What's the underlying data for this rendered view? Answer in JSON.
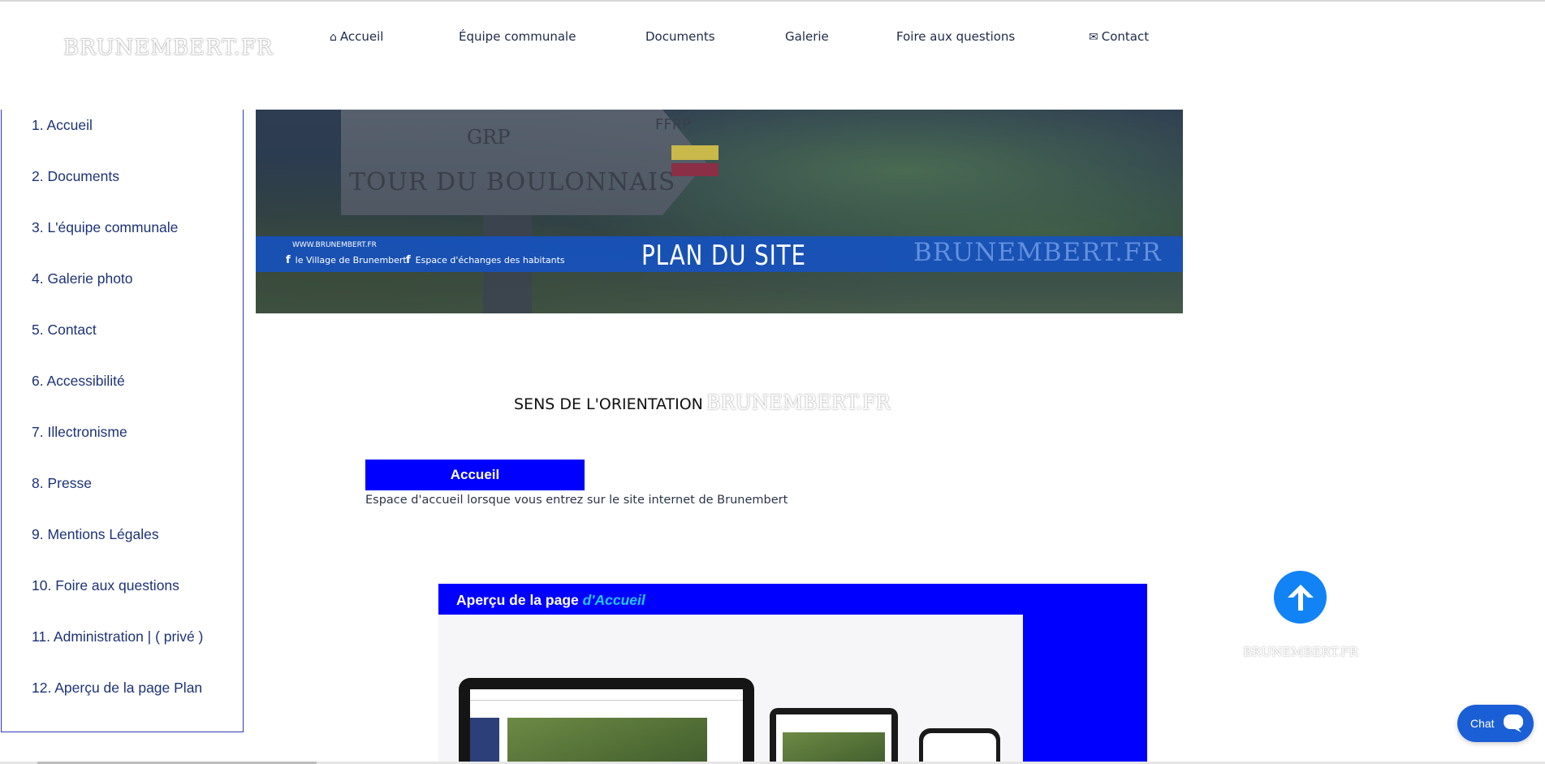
{
  "header": {
    "logo": "BRUNEMBERT.FR",
    "nav": [
      {
        "label": "Accueil",
        "icon": "home-icon"
      },
      {
        "label": "Équipe communale"
      },
      {
        "label": "Documents"
      },
      {
        "label": "Galerie"
      },
      {
        "label": "Foire aux questions"
      },
      {
        "label": "Contact",
        "icon": "envelope-icon"
      }
    ]
  },
  "sidebar": {
    "items": [
      "1. Accueil",
      "2. Documents",
      "3. L'équipe communale",
      "4. Galerie photo",
      "5. Contact",
      "6. Accessibilité",
      "7. Illectronisme",
      "8. Presse",
      "9. Mentions Légales",
      "10. Foire aux questions",
      "11. Administration | ( privé )",
      "12. Aperçu de la page Plan"
    ]
  },
  "banner": {
    "sign_line1": "GRP",
    "sign_line2": "TOUR DU BOULONNAIS",
    "sign_tag": "FFRP",
    "url": "WWW.BRUNEMBERT.FR",
    "facebook1": "le Village de Brunembert",
    "facebook2": "Espace d'échanges des habitants",
    "title": "PLAN DU SITE",
    "logo": "BRUNEMBERT.FR"
  },
  "orientation": {
    "text": "SENS DE L'ORIENTATION",
    "logo": "BRUNEMBERT.FR"
  },
  "accueil": {
    "button": "Accueil",
    "description": "Espace d'accueil lorsque vous entrez sur le site internet de Brunembert"
  },
  "preview": {
    "title_prefix": "Aperçu de la page ",
    "title_highlight": "d'Accueil"
  },
  "back_to_top": {
    "logo": "BRUNEMBERT.FR"
  },
  "chat": {
    "label": "Chat"
  },
  "colors": {
    "accent_blue": "#0000ff",
    "nav_text": "#1e2a4a",
    "sidebar_text": "#1d3278",
    "back_to_top": "#1183f4",
    "chat": "#1b5fd6",
    "highlight": "#23c7ff"
  }
}
